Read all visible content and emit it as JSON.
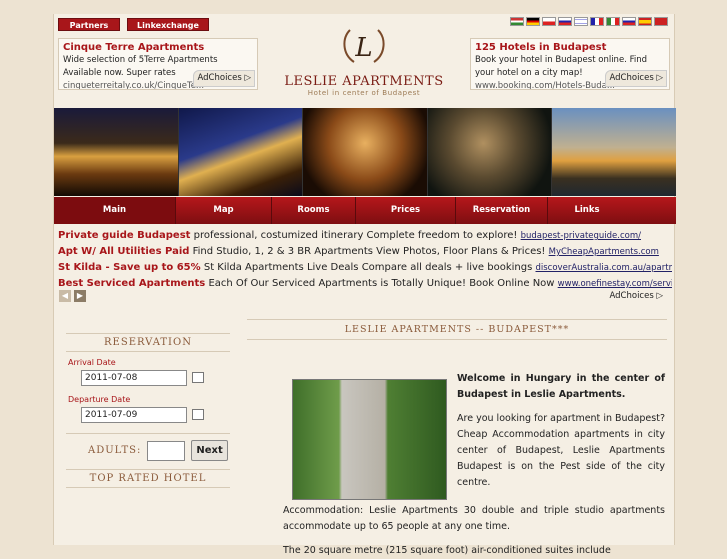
{
  "top_buttons": {
    "partners": "Partners",
    "linkexchange": "Linkexchange"
  },
  "ads_top": [
    {
      "title": "Cinque Terre Apartments",
      "body": "Wide selection of 5Terre Apartments Available now. Super rates",
      "url": "cinqueterreitaly.co.uk/CinqueTe..."
    },
    {
      "title": "125 Hotels in Budapest",
      "body": "Book your hotel in Budapest online. Find your hotel on a city map!",
      "url": "www.booking.com/Hotels-Buda..."
    }
  ],
  "adchoices": "AdChoices ▷",
  "logo": {
    "letter": "L",
    "brand": "LESLIE APARTMENTS",
    "sub": "Hotel in center of Budapest"
  },
  "nav": [
    "Main",
    "Map",
    "Rooms",
    "Prices",
    "Reservation",
    "Links"
  ],
  "text_links": [
    {
      "title": "Private guide Budapest",
      "text": "professional, costumized itinerary Complete freedom to explore!",
      "url": "budapest-privateguide.com/"
    },
    {
      "title": "Apt W/ All Utilities Paid",
      "text": "Find Studio, 1, 2 & 3 BR Apartments View Photos, Floor Plans & Prices!",
      "url": "MyCheapApartments.com"
    },
    {
      "title": "St Kilda - Save up to 65%",
      "text": "St Kilda Apartments Live Deals Compare all deals + live bookings",
      "url": "discoverAustralia.com.au/apartments"
    },
    {
      "title": "Best Serviced Apartments",
      "text": "Each Of Our Serviced Apartments is Totally Unique! Book Online Now",
      "url": "www.onefinestay.com/serviced"
    }
  ],
  "reservation": {
    "title": "RESERVATION",
    "arrival_label": "Arrival Date",
    "arrival": "2011-07-08",
    "departure_label": "Departure Date",
    "departure": "2011-07-09",
    "adults_label": "ADULTS:",
    "next": "Next",
    "top_rated": "TOP RATED HOTEL"
  },
  "main": {
    "title": "LESLIE APARTMENTS -- BUDAPEST***",
    "welcome": "Welcome in Hungary in the center of Budapest in Leslie Apartments.",
    "p1": "Are you looking for apartment in Budapest? Cheap Accommodation apartments in city center of Budapest, Leslie Apartments Budapest is on the Pest side of the city centre.",
    "p2": "Accommodation: Leslie Apartments 30 double and triple studio apartments accommodate up to 65 people at any one time.",
    "p3": "The 20 square metre (215 square foot) air-conditioned suites include"
  },
  "colors": {
    "accent": "#a8161a",
    "nav": "#9a1216"
  }
}
